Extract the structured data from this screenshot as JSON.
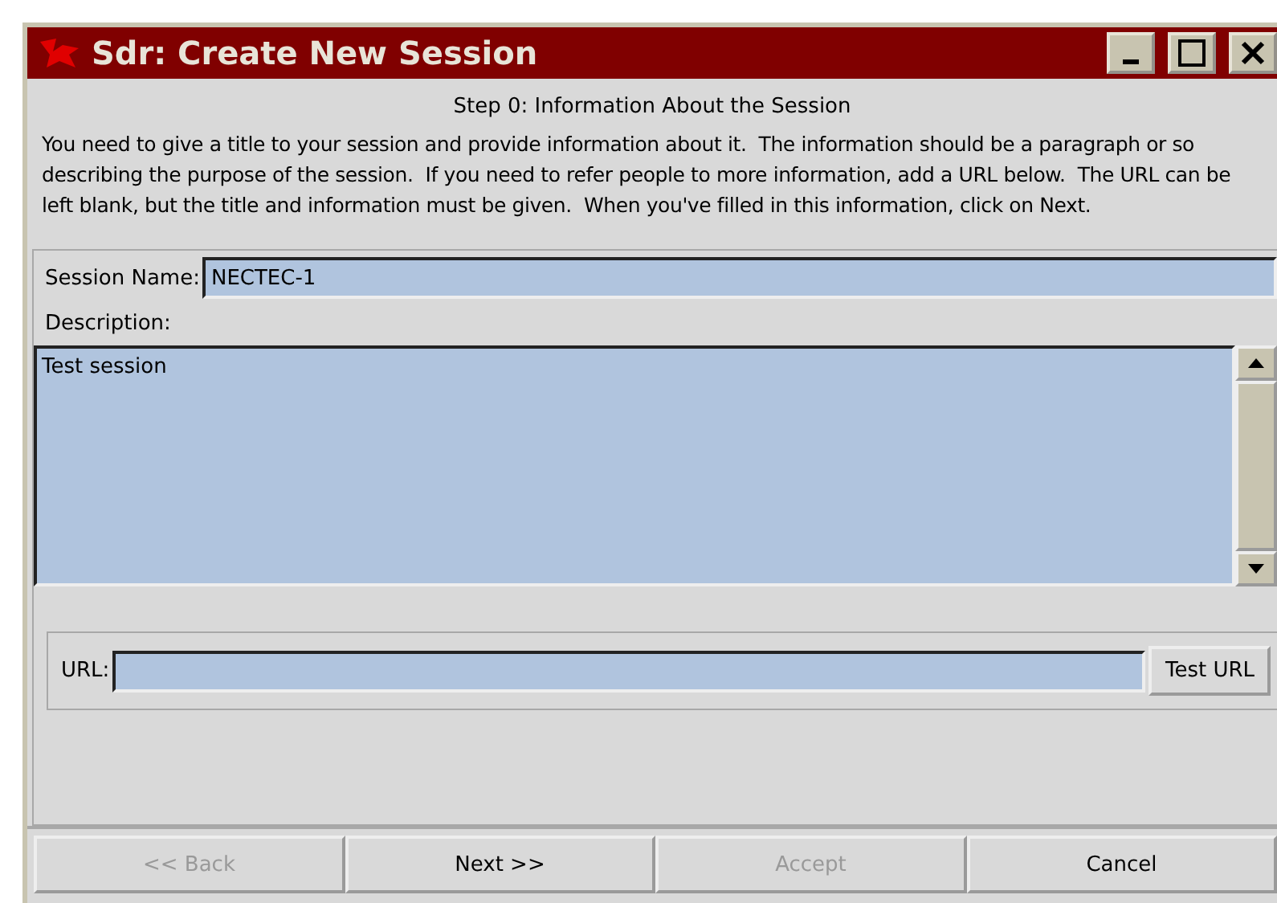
{
  "window": {
    "title": "Sdr: Create New Session"
  },
  "step_heading": "Step 0: Information About the Session",
  "instructions": "You need to give a title to your session and provide information about it.  The information should be a paragraph or so describing the purpose of the session.  If you need to refer people to more information, add a URL below.  The URL can be left blank, but the title and information must be given.  When you've filled in this information, click on Next.",
  "session_name": {
    "label": "Session Name:",
    "value": "NECTEC-1"
  },
  "description": {
    "label": "Description:",
    "value": "Test session"
  },
  "url": {
    "label": "URL:",
    "button": "Test URL"
  },
  "buttons": [
    {
      "label": "<< Back",
      "disabled": true
    },
    {
      "label": "Next >>",
      "disabled": false
    },
    {
      "label": "Accept",
      "disabled": true
    },
    {
      "label": "Cancel",
      "disabled": false
    }
  ]
}
